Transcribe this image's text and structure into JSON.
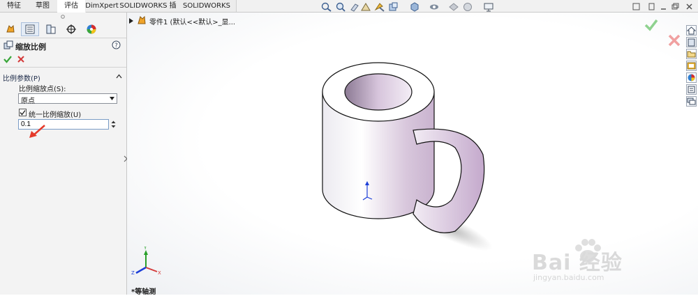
{
  "tabs": [
    {
      "label": "特征"
    },
    {
      "label": "草图"
    },
    {
      "label": "评估"
    },
    {
      "label": "DimXpert"
    },
    {
      "label": "SOLIDWORKS 插件"
    },
    {
      "label": "SOLIDWORKS MBD"
    }
  ],
  "tree": {
    "root_label": "零件1 (默认<<默认>_显..."
  },
  "property_manager": {
    "title": "缩放比例",
    "ok_icon": "check-icon",
    "cancel_icon": "close-icon",
    "section_title": "比例参数(P)",
    "scale_about_label": "比例缩放点(S):",
    "scale_about_value": "原点",
    "uniform_label": "统一比例缩放(U)",
    "uniform_checked": true,
    "scale_value": "0.1"
  },
  "view": {
    "orientation_label": "*等轴测"
  },
  "triad": {
    "x": "X",
    "y": "Y",
    "z": "Z"
  },
  "watermark": {
    "brand": "Bai 经验",
    "url": "jingyan.baidu.com"
  },
  "colors": {
    "accept_green": "#3aa63a",
    "reject_red": "#d43a3a",
    "arrow_red": "#e53a2a",
    "mug_pink": "#c9b3cf"
  }
}
